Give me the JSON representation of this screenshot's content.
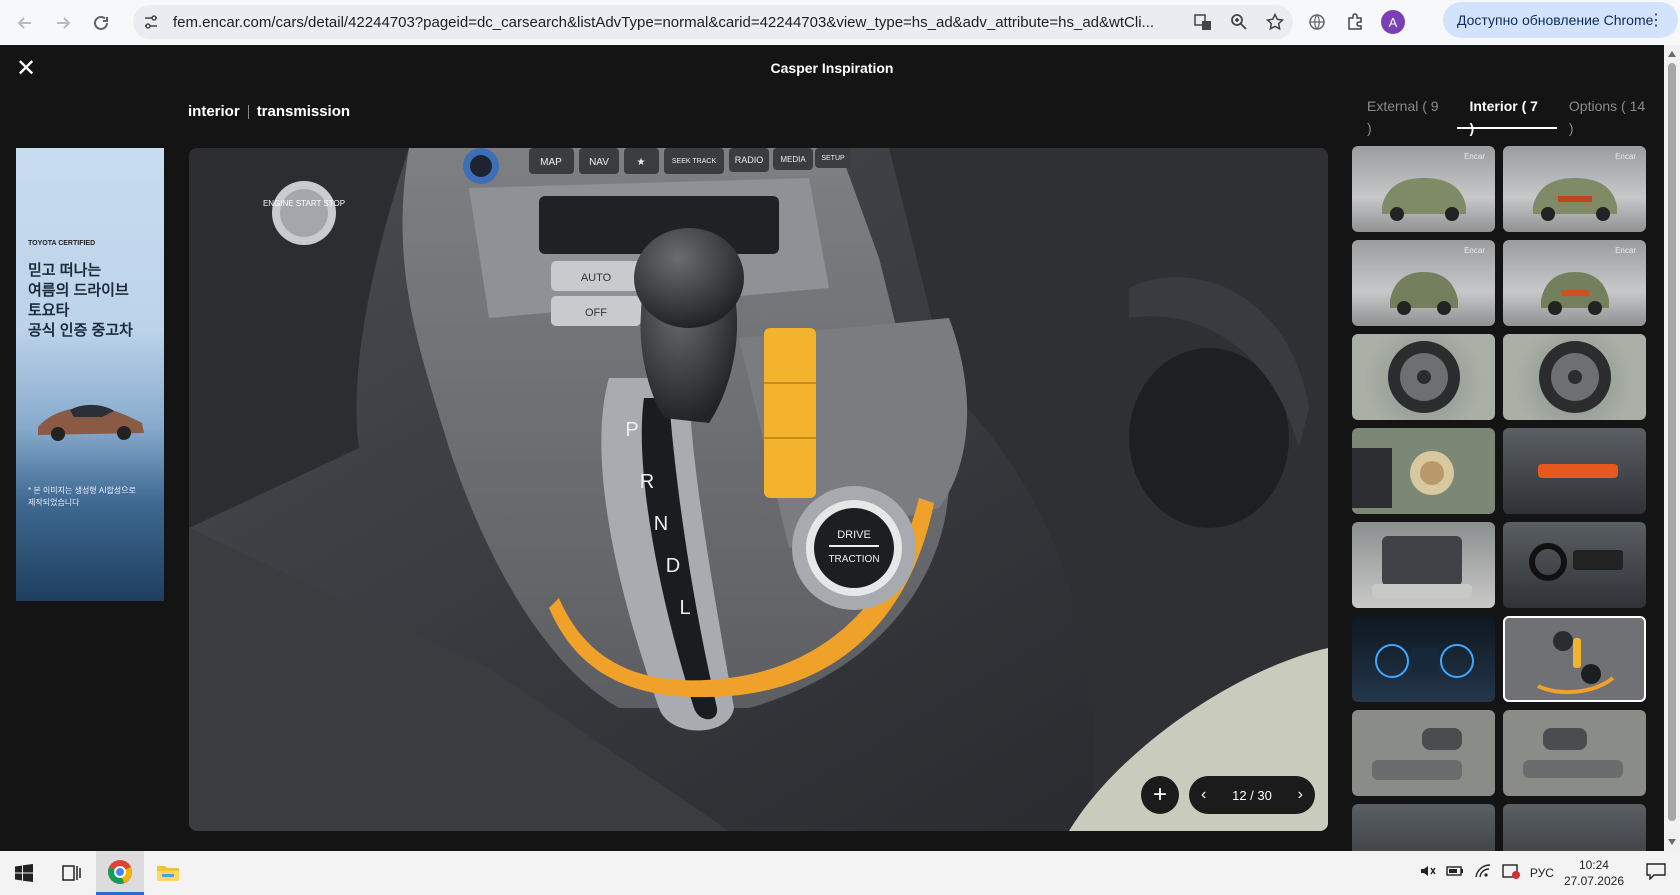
{
  "browser": {
    "url": "fem.encar.com/cars/detail/42244703?pageid=dc_carsearch&listAdvType=normal&carid=42244703&view_type=hs_ad&adv_attribute=hs_ad&wtCli...",
    "profile_initial": "A",
    "update_label": "Доступно обновление Chrome"
  },
  "viewer": {
    "title": "Casper Inspiration",
    "breadcrumb": [
      "interior",
      "transmission"
    ],
    "tabs": [
      {
        "label": "External ( 9 )",
        "active": false
      },
      {
        "label": "Interior ( 7 )",
        "active": true
      },
      {
        "label": "Options ( 14 )",
        "active": false
      }
    ],
    "pager": {
      "current": "12 / 30"
    },
    "thumbnails": [
      {
        "kind": "exterior",
        "watermark": "Encar"
      },
      {
        "kind": "exterior",
        "watermark": "Encar"
      },
      {
        "kind": "exterior",
        "watermark": "Encar"
      },
      {
        "kind": "exterior",
        "watermark": "Encar"
      },
      {
        "kind": "wheel"
      },
      {
        "kind": "wheel"
      },
      {
        "kind": "headlight"
      },
      {
        "kind": "taillight"
      },
      {
        "kind": "engine"
      },
      {
        "kind": "dashboard"
      },
      {
        "kind": "cluster"
      },
      {
        "kind": "shifter",
        "selected": true
      },
      {
        "kind": "door"
      },
      {
        "kind": "door"
      },
      {
        "kind": "seat"
      },
      {
        "kind": "seat"
      }
    ]
  },
  "ad": {
    "brand": "TOYOTA CERTIFIED",
    "headline": "믿고 떠나는\n여름의 드라이브\n토요타\n공식 인증 중고차",
    "fine_print": "* 본 이미지는 생성형 AI합성으로\n제작되었습니다"
  },
  "photo_labels": {
    "engine": "ENGINE START STOP",
    "buttons": [
      "MAP",
      "NAV",
      "★",
      "SEEK TRACK",
      "RADIO",
      "MEDIA",
      "SETUP"
    ],
    "climate": [
      "AUTO",
      "OFF"
    ],
    "gears": [
      "P",
      "R",
      "N",
      "D",
      "L"
    ],
    "knob_top": "DRIVE",
    "knob_bottom": "TRACTION"
  },
  "taskbar": {
    "language": "РУС",
    "time": "10:24",
    "date": "27.07.2026"
  }
}
